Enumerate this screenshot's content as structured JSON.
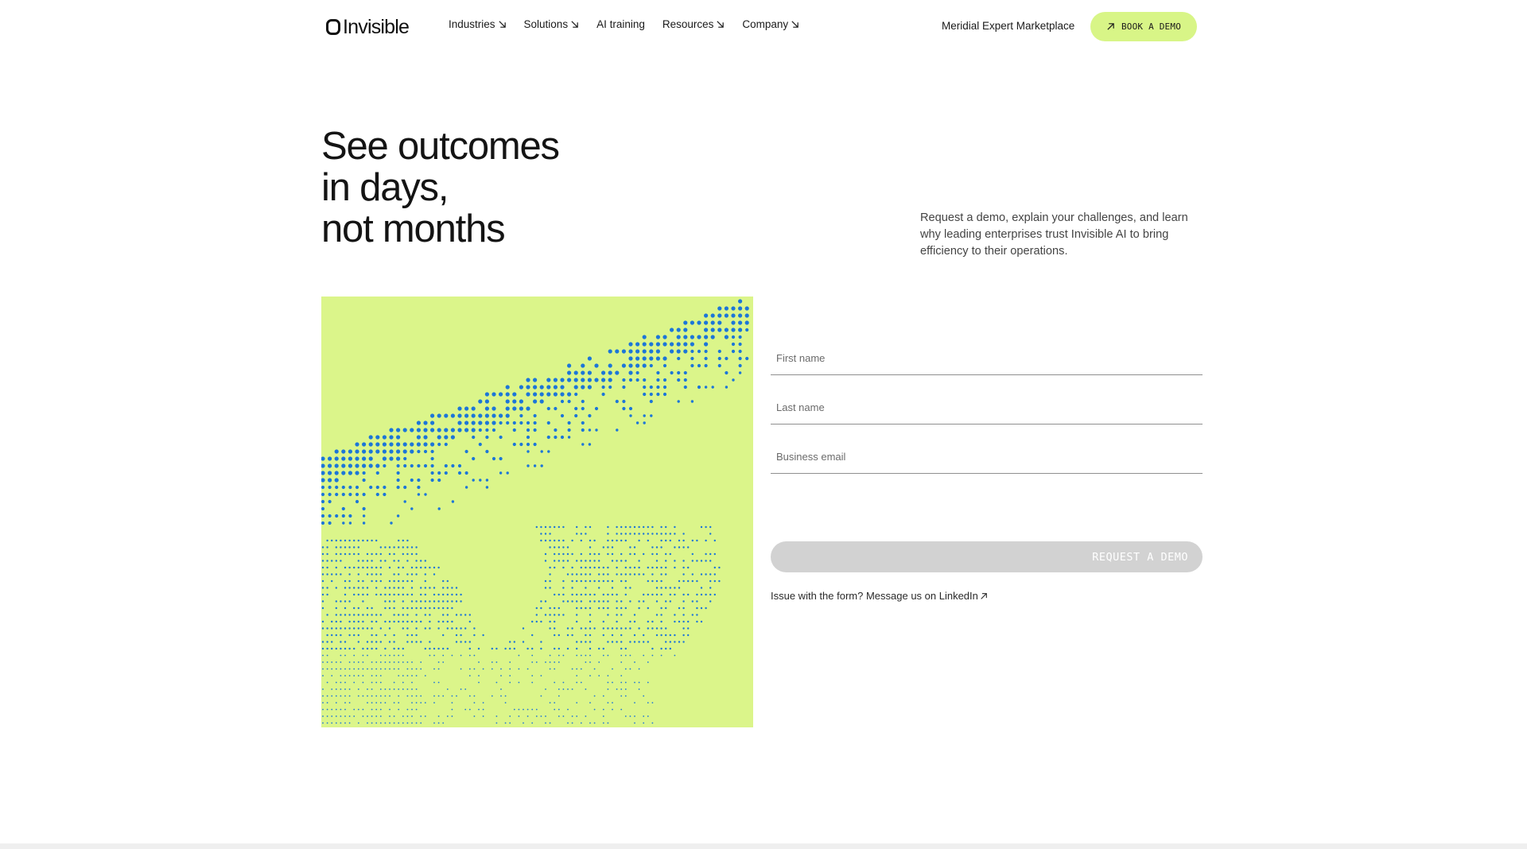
{
  "brand": {
    "name": "Invisible"
  },
  "nav": {
    "items": [
      {
        "label": "Industries",
        "has_dropdown": true
      },
      {
        "label": "Solutions",
        "has_dropdown": true
      },
      {
        "label": "AI training",
        "has_dropdown": false
      },
      {
        "label": "Resources",
        "has_dropdown": true
      },
      {
        "label": "Company",
        "has_dropdown": true
      }
    ],
    "marketplace_label": "Meridial Expert Marketplace",
    "cta_label": "BOOK A DEMO",
    "cta_icon": "arrow-up-right-icon"
  },
  "hero": {
    "title_lines": [
      "See outcomes",
      "in days,",
      "not months"
    ],
    "description": "Request a demo, explain your challenges, and learn why leading enterprises trust Invisible AI to bring efficiency to their operations."
  },
  "form": {
    "first_name": {
      "placeholder": "First name",
      "value": ""
    },
    "last_name": {
      "placeholder": "Last name",
      "value": ""
    },
    "email": {
      "placeholder": "Business email",
      "value": ""
    },
    "submit_label": "REQUEST A DEMO",
    "issue_text": "Issue with the form? ",
    "issue_link": "Message us on LinkedIn"
  },
  "colors": {
    "accent": "#d8f587",
    "art_background": "#dbf58a",
    "art_dots": "#1c76d8",
    "button_disabled": "#d2d2d2"
  }
}
